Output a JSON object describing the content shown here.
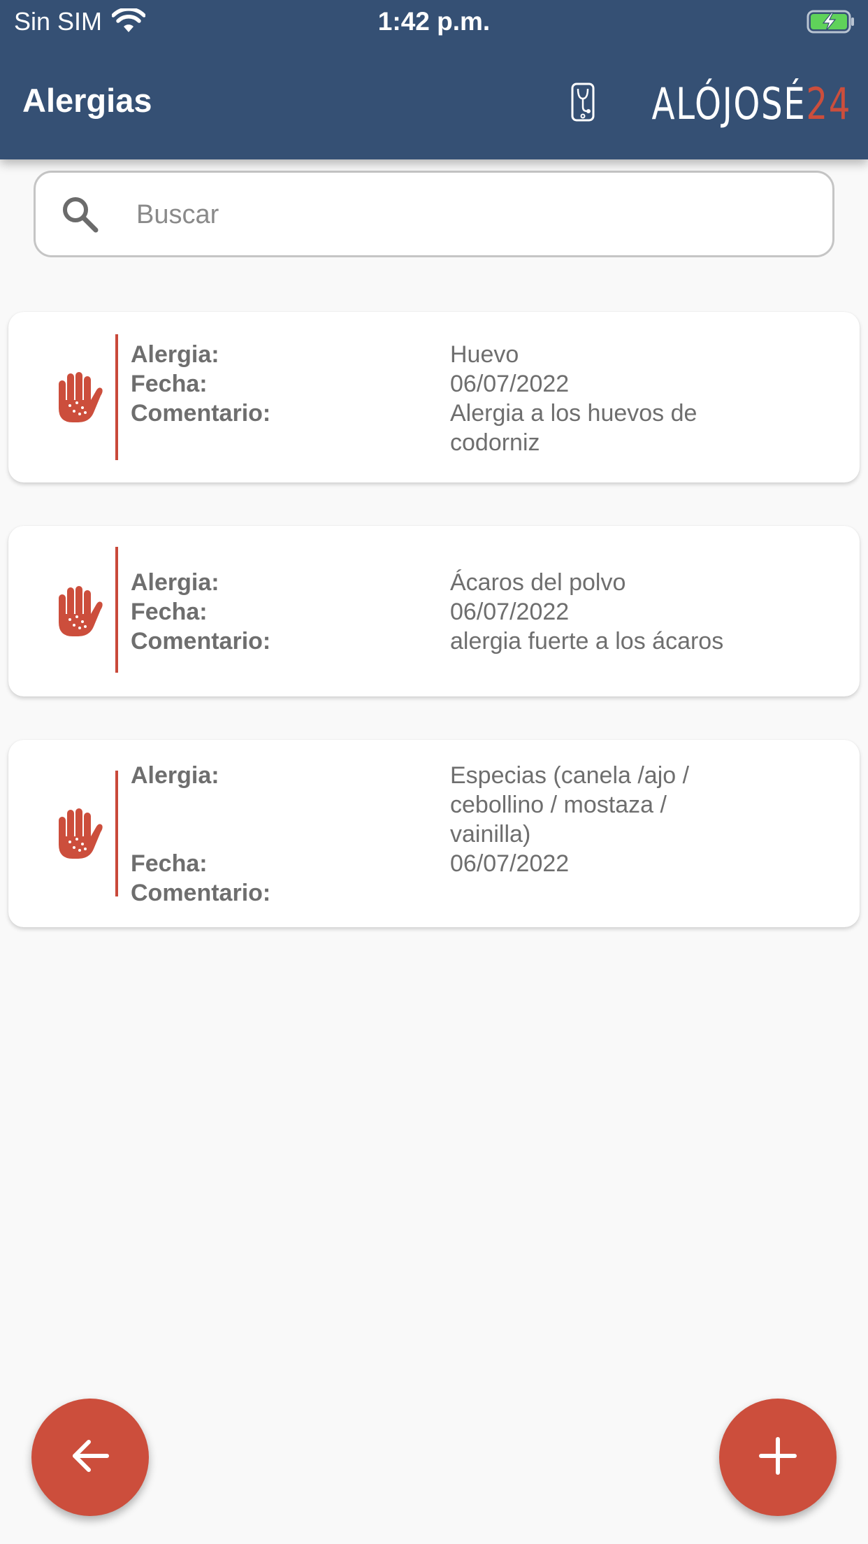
{
  "status_bar": {
    "carrier": "Sin SIM",
    "time": "1:42 p.m.",
    "wifi_icon": "wifi-icon",
    "battery_icon": "battery-charging-icon"
  },
  "header": {
    "title": "Alergias",
    "logo_text": "ALÓJOSÉ",
    "logo_number": "24"
  },
  "search": {
    "placeholder": "Buscar",
    "value": ""
  },
  "labels": {
    "allergy": "Alergia:",
    "date": "Fecha:",
    "comment": "Comentario:"
  },
  "allergies": [
    {
      "icon": "allergy-hand-icon",
      "name": "Huevo",
      "date": "06/07/2022",
      "comment": "Alergia a los huevos de codorniz"
    },
    {
      "icon": "allergy-hand-icon",
      "name": "Ácaros del polvo",
      "date": "06/07/2022",
      "comment": "alergia fuerte a los ácaros"
    },
    {
      "icon": "allergy-hand-icon",
      "name": "Especias (canela /ajo / cebollino / mostaza / vainilla)",
      "date": "06/07/2022",
      "comment": ""
    }
  ],
  "buttons": {
    "back_icon": "arrow-left-icon",
    "add_icon": "plus-icon"
  },
  "colors": {
    "header": "#355074",
    "accent": "#cc4e3c",
    "background": "#f9f9f9"
  }
}
